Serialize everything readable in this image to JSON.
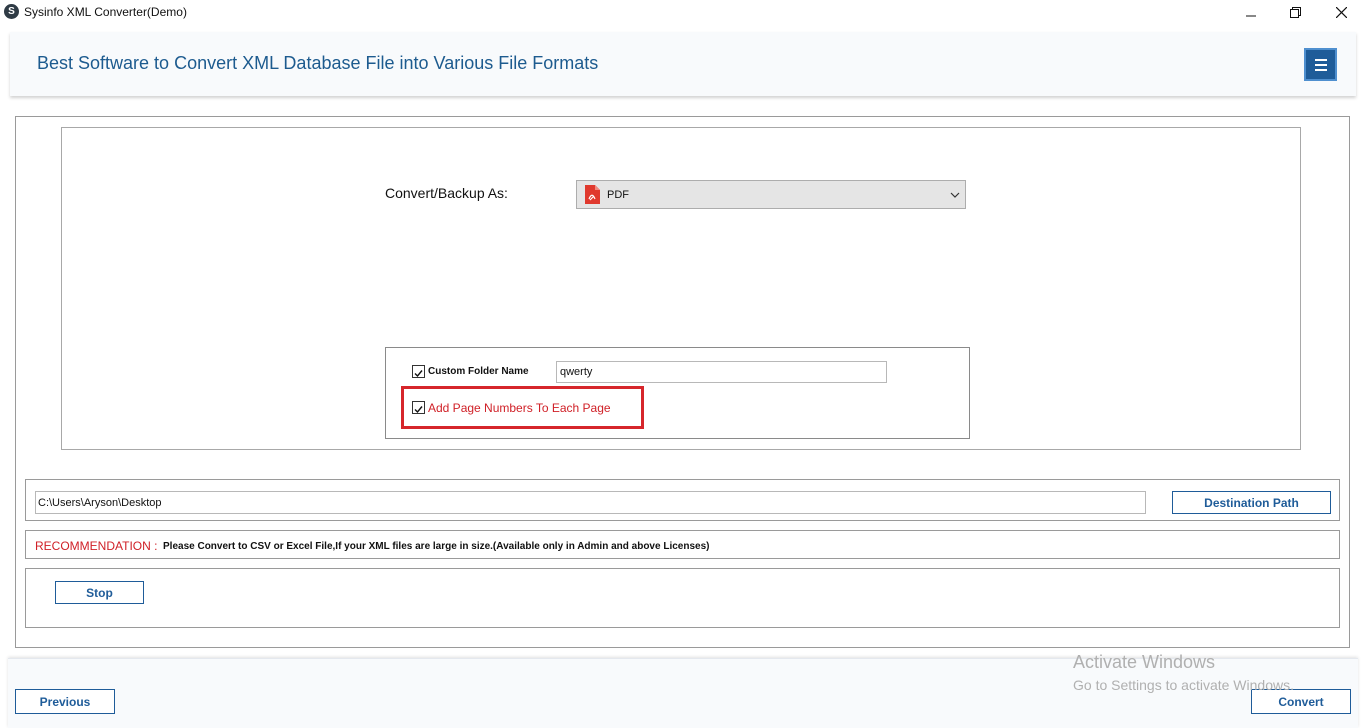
{
  "window": {
    "title": "Sysinfo XML Converter(Demo)",
    "icon": "sysinfo-logo-icon",
    "controls": [
      "minimize-icon",
      "restore-icon",
      "close-icon"
    ]
  },
  "header": {
    "title": "Best Software to Convert XML Database File into Various File Formats",
    "menu_icon": "hamburger-menu-icon"
  },
  "convert": {
    "label": "Convert/Backup As:",
    "selected_format": "PDF",
    "format_icon": "pdf-icon"
  },
  "options": {
    "custom_folder": {
      "label": "Custom Folder Name",
      "checked": true,
      "value": "qwerty"
    },
    "page_numbers": {
      "label": "Add Page Numbers To Each Page",
      "checked": true
    }
  },
  "destination": {
    "path": "C:\\Users\\Aryson\\Desktop",
    "button_label": "Destination Path"
  },
  "recommendation": {
    "label": "RECOMMENDATION :",
    "text": "Please Convert to CSV or Excel File,If your XML files are large in size.(Available only in Admin and above Licenses)"
  },
  "actions": {
    "stop_label": "Stop",
    "previous_label": "Previous",
    "convert_label": "Convert"
  },
  "watermark": {
    "title": "Activate Windows",
    "subtitle": "Go to Settings to activate Windows."
  },
  "colors": {
    "accent": "#1f5c99",
    "header_text": "#1d5b8f",
    "highlight": "#d6262b",
    "recommendation": "#d02027"
  }
}
